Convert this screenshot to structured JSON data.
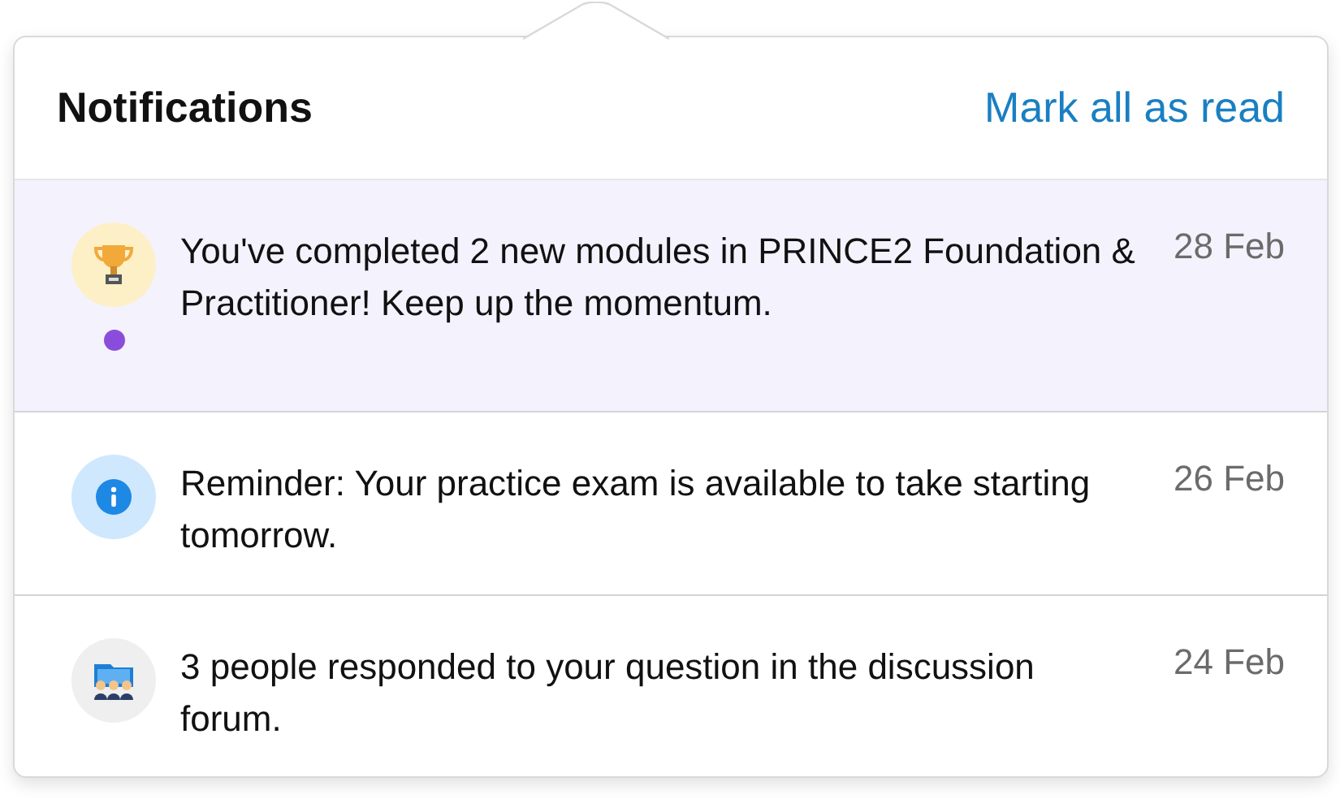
{
  "header": {
    "title": "Notifications",
    "action": "Mark all as read"
  },
  "notifications": [
    {
      "kind": "trophy",
      "text": "You've completed 2 new modules in PRINCE2 Foundation & Practitioner! Keep up the momentum.",
      "date": "28 Feb",
      "unread": true
    },
    {
      "kind": "info",
      "text": "Reminder: Your practice exam is available to take starting tomorrow.",
      "date": "26 Feb",
      "unread": false
    },
    {
      "kind": "forum",
      "text": "3 people responded to your question in the discussion forum.",
      "date": "24 Feb",
      "unread": false
    }
  ]
}
